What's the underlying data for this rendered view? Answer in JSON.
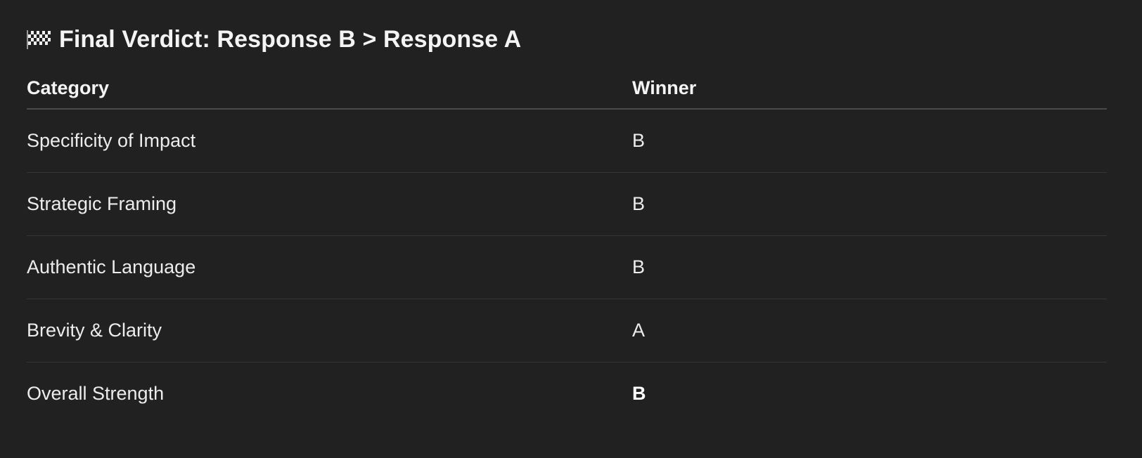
{
  "heading": {
    "icon": "checkered-flag-icon",
    "text": "Final Verdict: Response B > Response A"
  },
  "table": {
    "headers": [
      "Category",
      "Winner"
    ],
    "rows": [
      {
        "category": "Specificity of Impact",
        "winner": "B"
      },
      {
        "category": "Strategic Framing",
        "winner": "B"
      },
      {
        "category": "Authentic Language",
        "winner": "B"
      },
      {
        "category": "Brevity & Clarity",
        "winner": "A"
      },
      {
        "category": "Overall Strength",
        "winner": "B"
      }
    ]
  },
  "colors": {
    "background": "#212121",
    "text": "#f2f2f2",
    "header_rule": "#4a4a4a",
    "row_rule": "#353535"
  }
}
